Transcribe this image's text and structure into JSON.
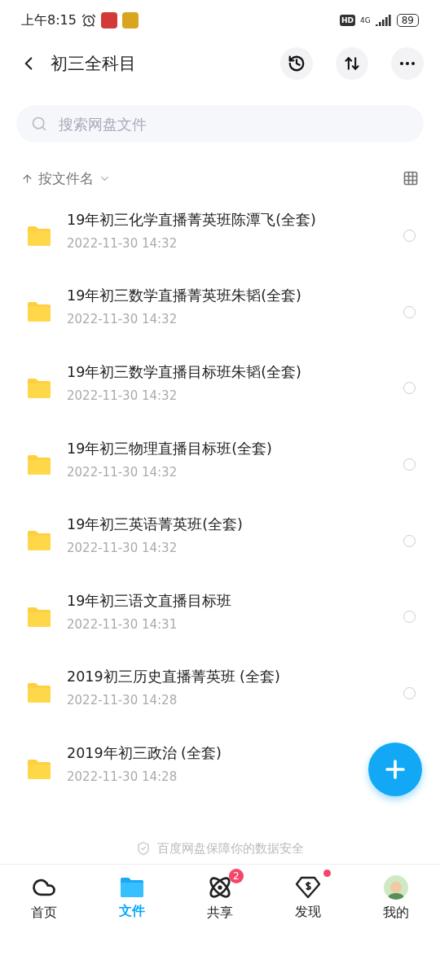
{
  "status_bar": {
    "time": "上午8:15",
    "hd": "HD",
    "network": "4G",
    "battery": "89"
  },
  "header": {
    "title": "初三全科目"
  },
  "search": {
    "placeholder": "搜索网盘文件"
  },
  "sort": {
    "label": "按文件名"
  },
  "files": [
    {
      "name": "19年初三化学直播菁英班陈潭飞(全套)",
      "date": "2022-11-30",
      "time": "14:32",
      "selected": false
    },
    {
      "name": "19年初三数学直播菁英班朱韬(全套)",
      "date": "2022-11-30",
      "time": "14:32",
      "selected": false
    },
    {
      "name": "19年初三数学直播目标班朱韬(全套)",
      "date": "2022-11-30",
      "time": "14:32",
      "selected": false
    },
    {
      "name": "19年初三物理直播目标班(全套)",
      "date": "2022-11-30",
      "time": "14:32",
      "selected": false
    },
    {
      "name": "19年初三英语菁英班(全套)",
      "date": "2022-11-30",
      "time": "14:32",
      "selected": false
    },
    {
      "name": "19年初三语文直播目标班",
      "date": "2022-11-30",
      "time": "14:31",
      "selected": false
    },
    {
      "name": "2019初三历史直播菁英班 (全套)",
      "date": "2022-11-30",
      "time": "14:28",
      "selected": false
    },
    {
      "name": "2019年初三政治 (全套)",
      "date": "2022-11-30",
      "time": "14:28"
    }
  ],
  "footer_note": "百度网盘保障你的数据安全",
  "tabs": [
    {
      "kind": "home",
      "label": "首页",
      "selected": false
    },
    {
      "kind": "files",
      "label": "文件",
      "selected": true
    },
    {
      "kind": "share",
      "label": "共享",
      "selected": false,
      "badge": "2"
    },
    {
      "kind": "discover",
      "label": "发现",
      "selected": false,
      "dot": true
    },
    {
      "kind": "me",
      "label": "我的",
      "selected": false
    }
  ]
}
